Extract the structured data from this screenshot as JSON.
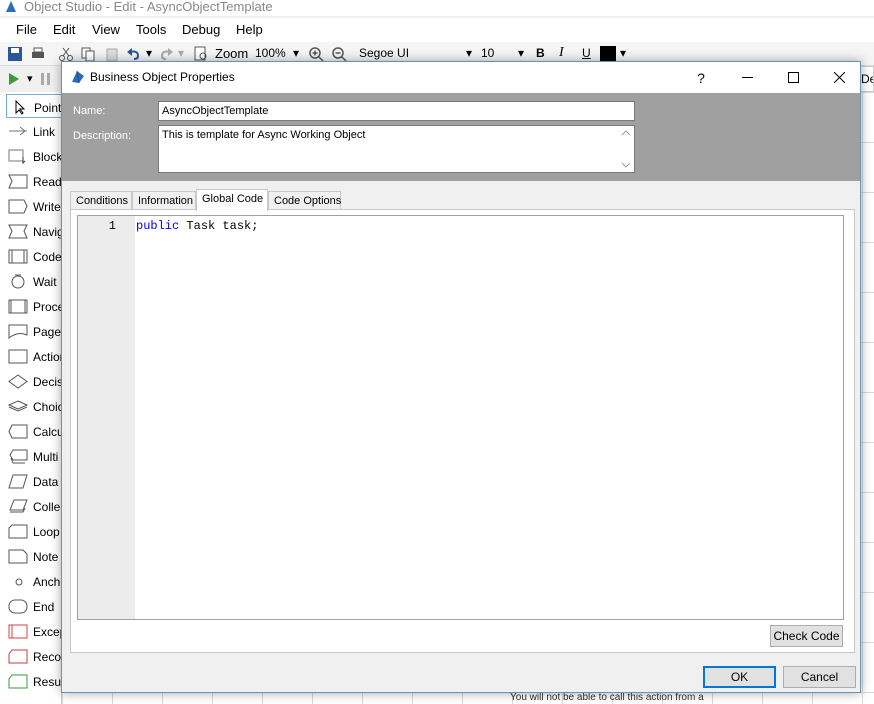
{
  "app": {
    "title": "Object Studio  - Edit - AsyncObjectTemplate",
    "menu": [
      "File",
      "Edit",
      "View",
      "Tools",
      "Debug",
      "Help"
    ],
    "toolbar": {
      "zoom_label": "Zoom",
      "zoom_value": "100%",
      "font_name": "Segoe UI",
      "font_size": "10",
      "bold": "B",
      "italic": "I",
      "underline": "U",
      "font_color": "#000000"
    },
    "right_tab_label": "De",
    "palette": [
      {
        "label": "Pointer",
        "icon": "pointer-icon"
      },
      {
        "label": "Link",
        "icon": "link-icon"
      },
      {
        "label": "Block",
        "icon": "block-icon"
      },
      {
        "label": "Read",
        "icon": "read-icon"
      },
      {
        "label": "Write",
        "icon": "write-icon"
      },
      {
        "label": "Navigate",
        "icon": "navigate-icon"
      },
      {
        "label": "Code",
        "icon": "code-icon"
      },
      {
        "label": "Wait",
        "icon": "wait-icon"
      },
      {
        "label": "Process",
        "icon": "process-icon"
      },
      {
        "label": "Page",
        "icon": "page-icon"
      },
      {
        "label": "Action",
        "icon": "action-icon"
      },
      {
        "label": "Decision",
        "icon": "decision-icon"
      },
      {
        "label": "Choice",
        "icon": "choice-icon"
      },
      {
        "label": "Calculation",
        "icon": "calculation-icon"
      },
      {
        "label": "Multi",
        "icon": "multi-calc-icon"
      },
      {
        "label": "Data",
        "icon": "data-icon"
      },
      {
        "label": "Collection",
        "icon": "collection-icon"
      },
      {
        "label": "Loop",
        "icon": "loop-icon"
      },
      {
        "label": "Note",
        "icon": "note-icon"
      },
      {
        "label": "Anchor",
        "icon": "anchor-icon"
      },
      {
        "label": "End",
        "icon": "end-icon"
      },
      {
        "label": "Exception",
        "icon": "exception-icon"
      },
      {
        "label": "Recover",
        "icon": "recover-icon"
      },
      {
        "label": "Resume",
        "icon": "resume-icon"
      }
    ],
    "canvas_note": "You will not be able to call this action from a"
  },
  "dialog": {
    "title": "Business Object Properties",
    "help_label": "?",
    "name_label": "Name:",
    "name_value": "AsyncObjectTemplate",
    "description_label": "Description:",
    "description_value": "This is template for Async Working Object",
    "tabs": [
      "Conditions",
      "Information",
      "Global Code",
      "Code Options"
    ],
    "active_tab": "Global Code",
    "code": {
      "line_number": "1",
      "keyword": "public",
      "rest": " Task task;"
    },
    "check_code_label": "Check Code",
    "ok_label": "OK",
    "cancel_label": "Cancel"
  },
  "colors": {
    "header_bg": "#a0a0a0",
    "keyword": "#0000ff",
    "default_button_border": "#0078d7"
  }
}
